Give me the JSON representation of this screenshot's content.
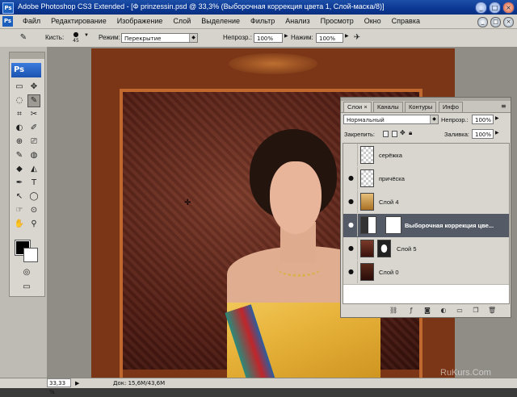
{
  "window": {
    "app_icon": "Ps",
    "title": "Adobe Photoshop CS3 Extended - [Ф prinzessin.psd @ 33,3% (Выборочная коррекция цвета 1, Слой-маска/8)]",
    "buttons": [
      "_",
      "□",
      "×"
    ]
  },
  "menu": {
    "items": [
      "Файл",
      "Редактирование",
      "Изображение",
      "Слой",
      "Выделение",
      "Фильтр",
      "Анализ",
      "Просмотр",
      "Окно",
      "Справка"
    ]
  },
  "options": {
    "brush_label": "Кисть:",
    "brush_size": "45",
    "mode_label": "Режим:",
    "mode_value": "Перекрытие",
    "opacity_label": "Непрозр.:",
    "opacity_value": "100%",
    "flow_label": "Нажим:",
    "flow_value": "100%"
  },
  "toolbox": {
    "logo": "Ps",
    "tools": [
      "▭",
      "✥",
      "◌",
      "✎",
      "⌗",
      "✂",
      "◐",
      "✐",
      "⊕",
      "⎚",
      "✎",
      "◍",
      "◆",
      "◭",
      "✒",
      "T",
      "↖",
      "◯",
      "☞",
      "⊙",
      "✋",
      "⚲"
    ],
    "active_index": 3
  },
  "layers": {
    "tabs": [
      "Слои",
      "Каналы",
      "Контуры",
      "Инфо"
    ],
    "blend_mode": "Нормальный",
    "opacity_label": "Непрозр.:",
    "opacity_value": "100%",
    "lock_label": "Закрепить:",
    "fill_label": "Заливка:",
    "fill_value": "100%",
    "rows": [
      {
        "name": "серёжка",
        "visible": false,
        "selected": false
      },
      {
        "name": "причёска",
        "visible": true,
        "selected": false
      },
      {
        "name": "Слой 4",
        "visible": true,
        "selected": false
      },
      {
        "name": "Выборочная коррекция цве...",
        "visible": true,
        "selected": true
      },
      {
        "name": "Слой 5",
        "visible": true,
        "selected": false
      },
      {
        "name": "Слой 0",
        "visible": true,
        "selected": false
      }
    ],
    "footer_icons": [
      "link-icon",
      "fx-icon",
      "mask-icon",
      "adjustment-icon",
      "folder-icon",
      "new-layer-icon",
      "trash-icon"
    ]
  },
  "status": {
    "zoom": "33,33 %",
    "doc": "Док: 15,6M/43,6M"
  },
  "watermark": "RuKurs.Com"
}
